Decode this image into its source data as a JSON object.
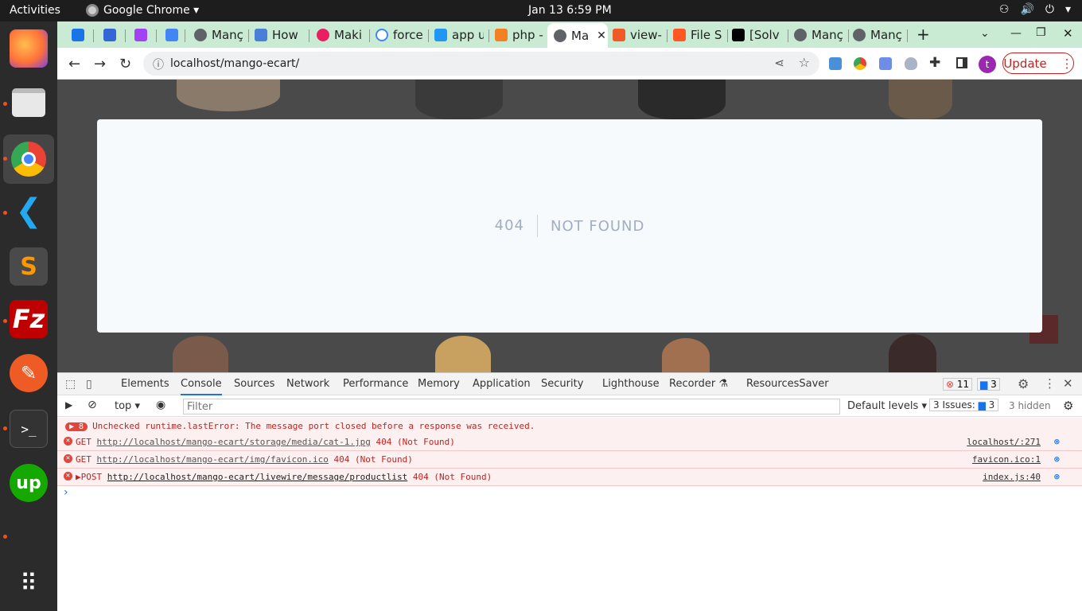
{
  "topbar": {
    "activities": "Activities",
    "app": "Google Chrome ▾",
    "clock": "Jan 13  6:59 PM",
    "tray": [
      "⚇",
      "🔊",
      "⏻",
      "▾"
    ]
  },
  "dock": [
    "firefox-icon",
    "files-icon",
    "chrome-icon",
    "vscode-icon",
    "sublime-icon",
    "filezilla-icon",
    "postman-icon",
    "terminal-icon",
    "upwork-icon",
    "apps-grid-icon"
  ],
  "tabs": [
    {
      "label": "",
      "color": "#1a73e8"
    },
    {
      "label": "",
      "color": "#3367d6"
    },
    {
      "label": "",
      "color": "#a142f4"
    },
    {
      "label": "",
      "color": "#4285f4"
    },
    {
      "label": "Manç",
      "color": "#5f6368"
    },
    {
      "label": "How",
      "color": "#4a7fd8"
    },
    {
      "label": "Maki",
      "color": "#e91e63"
    },
    {
      "label": "force",
      "color": "#4285f4"
    },
    {
      "label": "app u",
      "color": "#2196f3"
    },
    {
      "label": "php -",
      "color": "#f48024"
    },
    {
      "label": "Ma",
      "color": "#5f6368"
    },
    {
      "label": "view-",
      "color": "#f05a28"
    },
    {
      "label": "File S",
      "color": "#ff5722"
    },
    {
      "label": "[Solv",
      "color": "#000000"
    },
    {
      "label": "Manç",
      "color": "#5f6368"
    },
    {
      "label": "Manç",
      "color": "#5f6368"
    }
  ],
  "toolbar": {
    "url": "localhost/mango-ecart/",
    "update": "Update"
  },
  "page": {
    "code": "404",
    "message": "NOT FOUND"
  },
  "devtools": {
    "tabs": [
      "Elements",
      "Console",
      "Sources",
      "Network",
      "Performance",
      "Memory",
      "Application",
      "Security",
      "Lighthouse",
      "Recorder ⚗",
      "ResourcesSaver"
    ],
    "errors": "11",
    "messages": "3",
    "context": "top",
    "filter_placeholder": "Filter",
    "levels": "Default levels ▾",
    "issues": "3 Issues:",
    "issues_count": "3",
    "hidden": "3 hidden",
    "rows": [
      {
        "count": "▶ 8",
        "text": "Unchecked runtime.lastError: The message port closed before a response was received.",
        "src": ""
      },
      {
        "prefix": "GET ",
        "link": "http://localhost/mango-ecart/storage/media/cat-1.jpg",
        "suffix": " 404 (Not Found)",
        "src": "localhost/:271"
      },
      {
        "prefix": "GET ",
        "link": "http://localhost/mango-ecart/img/favicon.ico",
        "suffix": " 404 (Not Found)",
        "src": "favicon.ico:1"
      },
      {
        "prefix": "▶POST ",
        "link": "http://localhost/mango-ecart/livewire/message/productlist",
        "suffix": " 404 (Not Found)",
        "src": "index.js:40"
      }
    ],
    "prompt": "›"
  }
}
